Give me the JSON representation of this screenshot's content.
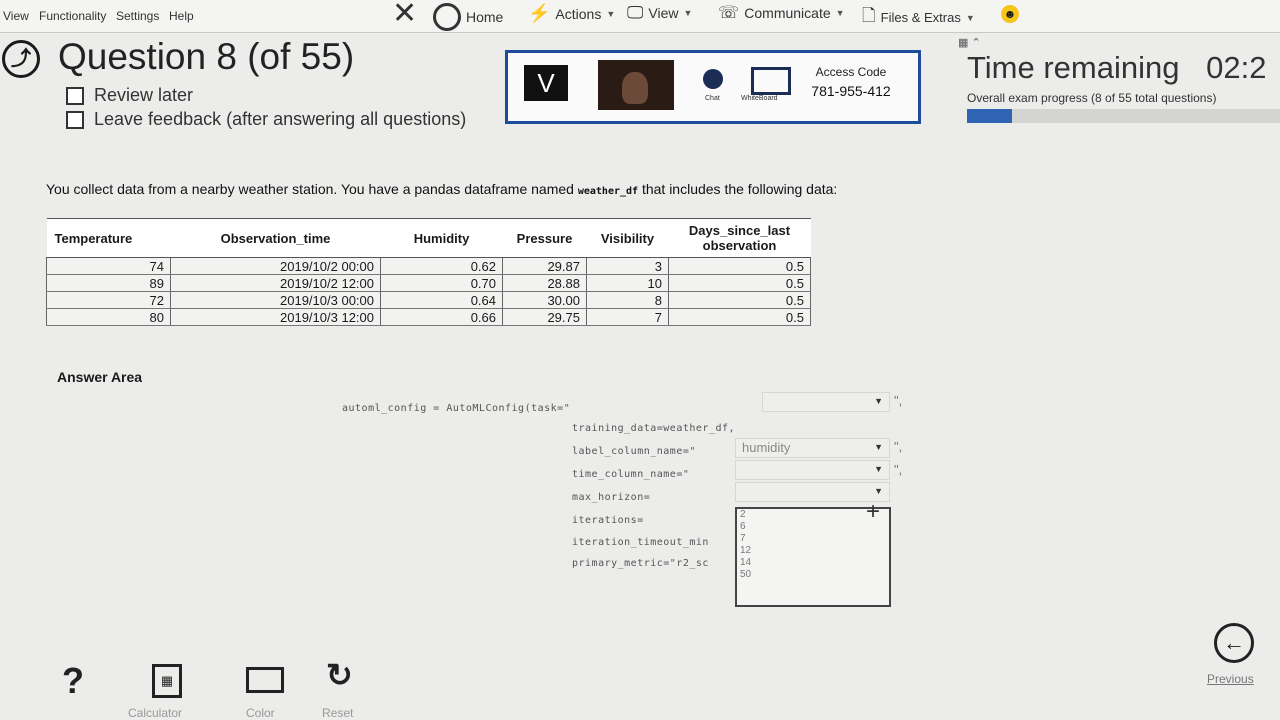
{
  "menu": [
    "View",
    "Functionality",
    "Settings",
    "Help"
  ],
  "toolbar": {
    "home": "Home",
    "actions": "Actions",
    "view": "View",
    "communicate": "Communicate",
    "files": "Files & Extras"
  },
  "question": {
    "title": "Question 8 (of 55)",
    "review_later": "Review later",
    "leave_feedback": "Leave feedback (after answering all questions)"
  },
  "proctor": {
    "logo_letter": "V",
    "chat": "Chat",
    "whiteboard": "WhiteBoard",
    "access_label": "Access Code",
    "access_code": "781-955-412"
  },
  "timer": {
    "label": "Time remaining",
    "value": "02:2",
    "progress_text": "Overall exam progress (8 of 55 total questions)",
    "progress_fraction": 0.145
  },
  "intro": {
    "before": "You collect data from a nearby weather station. You have a pandas dataframe named ",
    "code": "weather_df",
    "after": " that includes the following data:"
  },
  "table": {
    "headers": [
      "Temperature",
      "Observation_time",
      "Humidity",
      "Pressure",
      "Visibility",
      "Days_since_last observation"
    ],
    "rows": [
      [
        "74",
        "2019/10/2 00:00",
        "0.62",
        "29.87",
        "3",
        "0.5"
      ],
      [
        "89",
        "2019/10/2 12:00",
        "0.70",
        "28.88",
        "10",
        "0.5"
      ],
      [
        "72",
        "2019/10/3 00:00",
        "0.64",
        "30.00",
        "8",
        "0.5"
      ],
      [
        "80",
        "2019/10/3 12:00",
        "0.66",
        "29.75",
        "7",
        "0.5"
      ]
    ]
  },
  "answer": {
    "label": "Answer Area",
    "line1": "automl_config = AutoMLConfig(task=\"",
    "line2": "training_data=weather_df,",
    "line3": "label_column_name=\"",
    "line3_value": "humidity",
    "line4": "time_column_name=\"",
    "line5": "max_horizon=",
    "line6": "iterations=",
    "line7": "iteration_timeout_min",
    "line8": "primary_metric=\"r2_sc",
    "trail1": "\",",
    "trail3": "\",",
    "trail4": "\",",
    "list_options": [
      "2",
      "6",
      "7",
      "12",
      "14",
      "50"
    ]
  },
  "bottom": {
    "help_glyph": "?",
    "calculator": "Calculator",
    "color": "Color",
    "reset": "Reset",
    "previous": "Previous"
  }
}
